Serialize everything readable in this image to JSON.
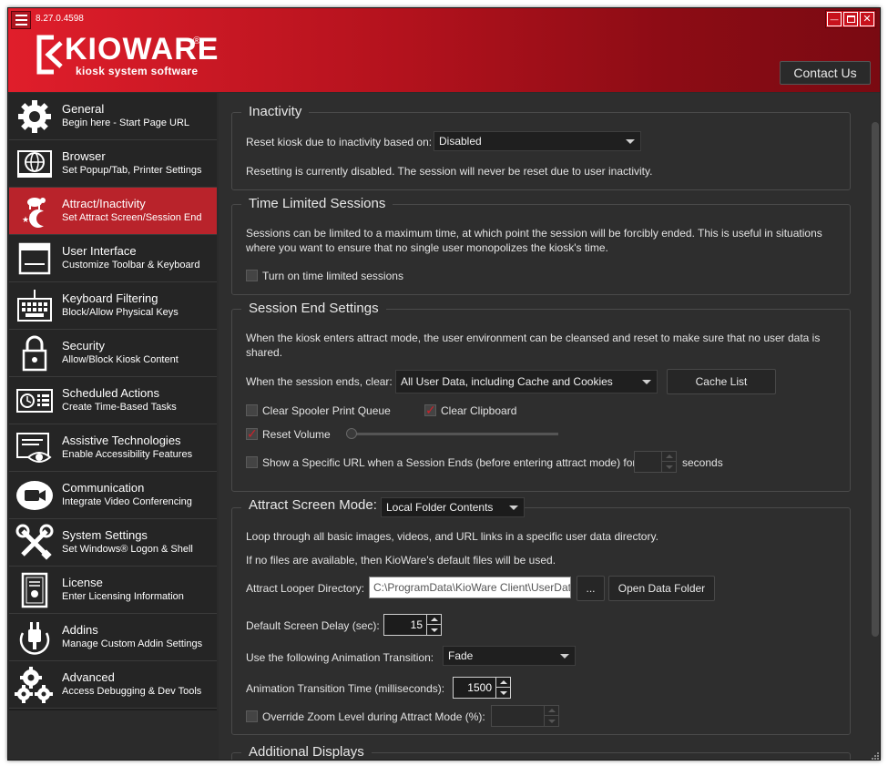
{
  "app": {
    "version": "8.27.0.4598",
    "logo_word": "KIOWARE",
    "logo_reg": "®",
    "logo_tagline": "kiosk system software",
    "contact_label": "Contact Us",
    "window_controls": {
      "minimize": "—",
      "close": "✕"
    }
  },
  "sidebar": {
    "items": [
      {
        "title": "General",
        "subtitle": "Begin here - Start Page URL",
        "icon": "gear-icon"
      },
      {
        "title": "Browser",
        "subtitle": "Set Popup/Tab, Printer Settings",
        "icon": "browser-icon"
      },
      {
        "title": "Attract/Inactivity",
        "subtitle": "Set Attract Screen/Session End",
        "icon": "night-sheep-icon"
      },
      {
        "title": "User Interface",
        "subtitle": "Customize Toolbar & Keyboard",
        "icon": "window-icon"
      },
      {
        "title": "Keyboard Filtering",
        "subtitle": "Block/Allow Physical Keys",
        "icon": "keyboard-icon"
      },
      {
        "title": "Security",
        "subtitle": "Allow/Block Kiosk Content",
        "icon": "lock-icon"
      },
      {
        "title": "Scheduled Actions",
        "subtitle": "Create Time-Based Tasks",
        "icon": "clock-list-icon"
      },
      {
        "title": "Assistive Technologies",
        "subtitle": "Enable Accessibility Features",
        "icon": "eye-screen-icon"
      },
      {
        "title": "Communication",
        "subtitle": "Integrate Video Conferencing",
        "icon": "video-camera-icon"
      },
      {
        "title": "System Settings",
        "subtitle": "Set Windows® Logon & Shell",
        "icon": "tools-icon"
      },
      {
        "title": "License",
        "subtitle": "Enter Licensing Information",
        "icon": "certificate-icon"
      },
      {
        "title": "Addins",
        "subtitle": "Manage Custom Addin Settings",
        "icon": "plug-icon"
      },
      {
        "title": "Advanced",
        "subtitle": "Access Debugging & Dev Tools",
        "icon": "gears-icon"
      }
    ],
    "active_index": 2
  },
  "inactivity": {
    "title": "Inactivity",
    "reset_label": "Reset kiosk due to inactivity based on:",
    "reset_value": "Disabled",
    "status": "Resetting is currently disabled. The session will never be reset due to user inactivity."
  },
  "time_limited": {
    "title": "Time Limited Sessions",
    "desc_line1": "Sessions can be limited to a maximum time, at which point the session will be forcibly ended. This is useful in situations",
    "desc_line2": "where you want to ensure that no single user monopolizes the kiosk's time.",
    "toggle_label": "Turn on time limited sessions",
    "toggle_checked": false
  },
  "session_end": {
    "title": "Session End Settings",
    "desc_line1": "When the kiosk enters attract mode, the user environment can be cleansed and reset to make sure that no user data is",
    "desc_line2": "shared.",
    "clear_label": "When the session ends, clear:",
    "clear_value": "All User Data, including Cache and Cookies",
    "cache_list_label": "Cache List",
    "spooler_label": "Clear Spooler Print Queue",
    "spooler_checked": false,
    "clipboard_label": "Clear Clipboard",
    "clipboard_checked": true,
    "reset_volume_label": "Reset Volume",
    "reset_volume_checked": true,
    "volume_level": 0,
    "url_label": "Show a Specific URL when a Session Ends (before entering attract mode) for",
    "url_checked": false,
    "seconds_value": "",
    "seconds_label": "seconds"
  },
  "attract": {
    "title": "Attract Screen Mode:",
    "mode_value": "Local Folder Contents",
    "desc_line1": "Loop through all basic images, videos, and URL links in a specific user data directory.",
    "desc_line2": "If no files are available, then KioWare's default files will be used.",
    "dir_label": "Attract Looper Directory:",
    "dir_value": "C:\\ProgramData\\KioWare Client\\UserData",
    "browse_label": "...",
    "open_folder_label": "Open Data Folder",
    "delay_label": "Default Screen Delay (sec):",
    "delay_value": "15",
    "transition_label": "Use the following Animation Transition:",
    "transition_value": "Fade",
    "transition_time_label": "Animation Transition Time (milliseconds):",
    "transition_time_value": "1500",
    "zoom_label": "Override Zoom Level during Attract Mode (%):",
    "zoom_checked": false,
    "zoom_value": ""
  },
  "additional": {
    "title": "Additional Displays"
  }
}
